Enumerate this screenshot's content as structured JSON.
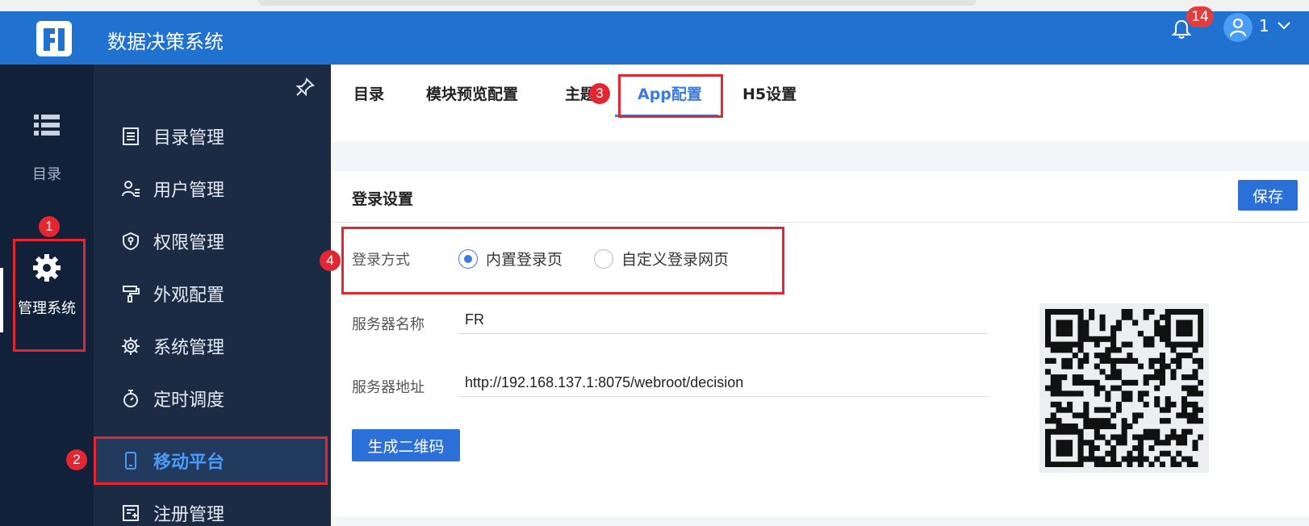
{
  "header": {
    "app_title": "数据决策系统",
    "notification_count": "14",
    "user_name": "1"
  },
  "rail": {
    "catalog_label": "目录",
    "manage_label": "管理系统"
  },
  "submenu": {
    "items": [
      {
        "label": "目录管理",
        "icon": "list-doc-icon"
      },
      {
        "label": "用户管理",
        "icon": "user-icon"
      },
      {
        "label": "权限管理",
        "icon": "shield-icon"
      },
      {
        "label": "外观配置",
        "icon": "paint-roller-icon"
      },
      {
        "label": "系统管理",
        "icon": "gear-icon"
      },
      {
        "label": "定时调度",
        "icon": "timer-icon"
      },
      {
        "label": "移动平台",
        "icon": "phone-icon",
        "active": true
      },
      {
        "label": "注册管理",
        "icon": "register-icon"
      }
    ]
  },
  "tabs": {
    "items": [
      "目录",
      "模块预览配置",
      "主题",
      "App配置",
      "H5设置"
    ],
    "active": "App配置"
  },
  "card": {
    "title": "登录设置",
    "save_label": "保存"
  },
  "form": {
    "login_method_label": "登录方式",
    "login_options": [
      "内置登录页",
      "自定义登录网页"
    ],
    "login_selected": "内置登录页",
    "server_name_label": "服务器名称",
    "server_name_value": "FR",
    "server_addr_label": "服务器地址",
    "server_addr_value": "http://192.168.137.1:8075/webroot/decision",
    "gen_qr_label": "生成二维码"
  },
  "annotations": {
    "steps": [
      "1",
      "2",
      "3",
      "4"
    ]
  },
  "colors": {
    "header_bg": "#2171d1",
    "rail_bg": "#11213a",
    "submenu_bg": "#1c2b44",
    "accent": "#3d7be0",
    "annotation_red": "#e3262f"
  }
}
